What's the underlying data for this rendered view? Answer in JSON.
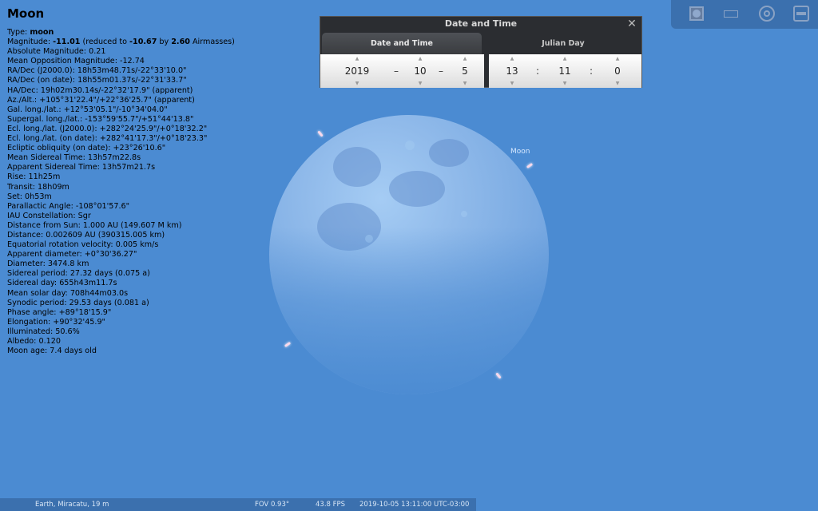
{
  "info": {
    "object_name": "Moon",
    "lines": [
      [
        {
          "t": "Type: "
        },
        {
          "t": "moon",
          "b": true
        }
      ],
      [
        {
          "t": "Magnitude: "
        },
        {
          "t": "-11.01",
          "b": true
        },
        {
          "t": " (reduced to "
        },
        {
          "t": "-10.67",
          "b": true
        },
        {
          "t": " by "
        },
        {
          "t": "2.60",
          "b": true
        },
        {
          "t": " Airmasses)"
        }
      ],
      [
        {
          "t": "Absolute Magnitude: 0.21"
        }
      ],
      [
        {
          "t": "Mean Opposition Magnitude: -12.74"
        }
      ],
      [
        {
          "t": "RA/Dec (J2000.0): 18h53m48.71s/-22°33'10.0\""
        }
      ],
      [
        {
          "t": "RA/Dec (on date): 18h55m01.37s/-22°31'33.7\""
        }
      ],
      [
        {
          "t": "HA/Dec: 19h02m30.14s/-22°32'17.9\" (apparent)"
        }
      ],
      [
        {
          "t": "Az./Alt.: +105°31'22.4\"/+22°36'25.7\" (apparent)"
        }
      ],
      [
        {
          "t": "Gal. long./lat.: +12°53'05.1\"/-10°34'04.0\""
        }
      ],
      [
        {
          "t": "Supergal. long./lat.: -153°59'55.7\"/+51°44'13.8\""
        }
      ],
      [
        {
          "t": "Ecl. long./lat. (J2000.0): +282°24'25.9\"/+0°18'32.2\""
        }
      ],
      [
        {
          "t": "Ecl. long./lat. (on date): +282°41'17.3\"/+0°18'23.3\""
        }
      ],
      [
        {
          "t": "Ecliptic obliquity (on date): +23°26'10.6\""
        }
      ],
      [
        {
          "t": "Mean Sidereal Time: 13h57m22.8s"
        }
      ],
      [
        {
          "t": "Apparent Sidereal Time: 13h57m21.7s"
        }
      ],
      [
        {
          "t": "Rise: 11h25m"
        }
      ],
      [
        {
          "t": "Transit: 18h09m"
        }
      ],
      [
        {
          "t": "Set: 0h53m"
        }
      ],
      [
        {
          "t": "Parallactic Angle: -108°01'57.6\""
        }
      ],
      [
        {
          "t": "IAU Constellation: Sgr"
        }
      ],
      [
        {
          "t": "Distance from Sun: 1.000 AU (149.607 M km)"
        }
      ],
      [
        {
          "t": "Distance: 0.002609 AU (390315.005 km)"
        }
      ],
      [
        {
          "t": "Equatorial rotation velocity: 0.005 km/s"
        }
      ],
      [
        {
          "t": "Apparent diameter: +0°30'36.27\""
        }
      ],
      [
        {
          "t": "Diameter: 3474.8 km"
        }
      ],
      [
        {
          "t": "Sidereal period: 27.32 days (0.075 a)"
        }
      ],
      [
        {
          "t": "Sidereal day: 655h43m11.7s"
        }
      ],
      [
        {
          "t": "Mean solar day: 708h44m03.0s"
        }
      ],
      [
        {
          "t": "Synodic period: 29.53 days (0.081 a)"
        }
      ],
      [
        {
          "t": "Phase angle: +89°18'15.9\""
        }
      ],
      [
        {
          "t": "Elongation: +90°32'45.9\""
        }
      ],
      [
        {
          "t": "Illuminated: 50.6%"
        }
      ],
      [
        {
          "t": "Albedo: 0.120"
        }
      ],
      [
        {
          "t": "Moon age: 7.4 days old"
        }
      ]
    ]
  },
  "sky": {
    "moon_label": "Moon",
    "background_color": "#4b8bd2"
  },
  "datetime_dialog": {
    "title": "Date and Time",
    "close_glyph": "✕",
    "tabs": [
      "Date and Time",
      "Julian Day"
    ],
    "date": {
      "year": "2019",
      "month": "10",
      "day": "5"
    },
    "time": {
      "hour": "13",
      "minute": "11",
      "second": "0"
    },
    "date_separator": "–",
    "time_separator": ":",
    "up_glyph": "▲",
    "down_glyph": "▼"
  },
  "toolbar": {
    "icons": [
      "window-icon",
      "rectangle-icon",
      "target-icon",
      "window-minus-icon"
    ]
  },
  "status_bar": {
    "location": "Earth, Miracatu, 19 m",
    "fov": "FOV 0.93°",
    "fps": "43.8 FPS",
    "datetime": "2019-10-05 13:11:00 UTC-03:00"
  }
}
